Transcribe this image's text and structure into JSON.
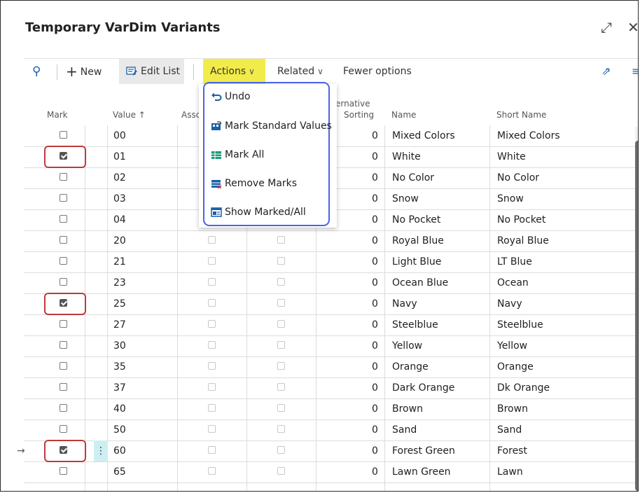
{
  "window": {
    "title": "Temporary VarDim Variants",
    "expand_glyph": "⤢",
    "close_glyph": "✕"
  },
  "toolbar": {
    "search_glyph": "⚲",
    "new_label": "New",
    "edit_list_label": "Edit List",
    "actions_label": "Actions",
    "related_label": "Related",
    "fewer_options_label": "Fewer options",
    "chevron_glyph": "∨",
    "share_glyph": "⇗",
    "list_glyph": "≡",
    "actions_highlight_color": "#f2ec4a"
  },
  "columns": {
    "mark": "Mark",
    "value": "Value ↑",
    "assoc": "Asso",
    "alt_sorting_1": "lternative",
    "alt_sorting_2": "Sorting",
    "name": "Name",
    "short_name": "Short Name"
  },
  "actions_menu": {
    "outline_color": "#4a63e7",
    "items": [
      {
        "label": "Undo",
        "icon": "undo-icon"
      },
      {
        "label": "Mark Standard Values",
        "icon": "mark-standard-icon"
      },
      {
        "label": "Mark All",
        "icon": "mark-all-icon"
      },
      {
        "label": "Remove Marks",
        "icon": "remove-marks-icon"
      },
      {
        "label": "Show Marked/All",
        "icon": "show-marked-icon"
      }
    ]
  },
  "rows": [
    {
      "value": "00",
      "sorting": "0",
      "name": "Mixed Colors",
      "short_name": "Mixed Colors",
      "marked": false
    },
    {
      "value": "01",
      "sorting": "0",
      "name": "White",
      "short_name": "White",
      "marked": true
    },
    {
      "value": "02",
      "sorting": "0",
      "name": "No Color",
      "short_name": "No Color",
      "marked": false
    },
    {
      "value": "03",
      "sorting": "0",
      "name": "Snow",
      "short_name": "Snow",
      "marked": false
    },
    {
      "value": "04",
      "sorting": "0",
      "name": "No Pocket",
      "short_name": "No Pocket",
      "marked": false
    },
    {
      "value": "20",
      "sorting": "0",
      "name": "Royal Blue",
      "short_name": "Royal Blue",
      "marked": false
    },
    {
      "value": "21",
      "sorting": "0",
      "name": "Light Blue",
      "short_name": "LT Blue",
      "marked": false
    },
    {
      "value": "23",
      "sorting": "0",
      "name": "Ocean Blue",
      "short_name": "Ocean",
      "marked": false
    },
    {
      "value": "25",
      "sorting": "0",
      "name": "Navy",
      "short_name": "Navy",
      "marked": true
    },
    {
      "value": "27",
      "sorting": "0",
      "name": "Steelblue",
      "short_name": "Steelblue",
      "marked": false
    },
    {
      "value": "30",
      "sorting": "0",
      "name": "Yellow",
      "short_name": "Yellow",
      "marked": false
    },
    {
      "value": "35",
      "sorting": "0",
      "name": "Orange",
      "short_name": "Orange",
      "marked": false
    },
    {
      "value": "37",
      "sorting": "0",
      "name": "Dark Orange",
      "short_name": "Dk Orange",
      "marked": false
    },
    {
      "value": "40",
      "sorting": "0",
      "name": "Brown",
      "short_name": "Brown",
      "marked": false
    },
    {
      "value": "50",
      "sorting": "0",
      "name": "Sand",
      "short_name": "Sand",
      "marked": false
    },
    {
      "value": "60",
      "sorting": "0",
      "name": "Forest Green",
      "short_name": "Forest",
      "marked": true,
      "current": true
    },
    {
      "value": "65",
      "sorting": "0",
      "name": "Lawn Green",
      "short_name": "Lawn",
      "marked": false
    }
  ],
  "marker_color": "#c0393b",
  "current_row_arrow": "→",
  "row_menu_glyph": "⋮"
}
